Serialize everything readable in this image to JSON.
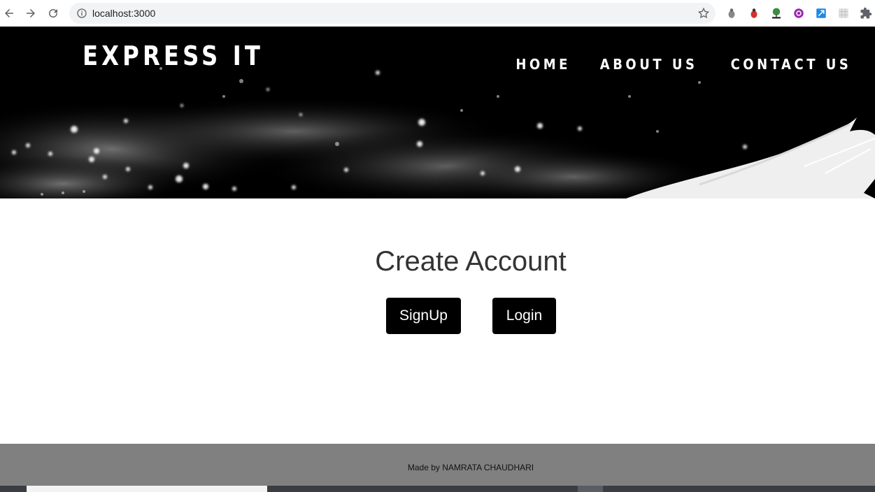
{
  "browser": {
    "url": "localhost:3000",
    "icons": [
      "back-icon",
      "forward-icon",
      "reload-icon",
      "info-icon",
      "star-icon",
      "bug-icon",
      "ladybug-icon",
      "tree-icon",
      "ext-purple-icon",
      "ext-blue-icon",
      "ext-grid-icon",
      "puzzle-icon"
    ]
  },
  "header": {
    "brand": "EXPRESS IT",
    "nav": [
      "HOME",
      "ABOUT US",
      "CONTACT US"
    ]
  },
  "main": {
    "title": "Create Account",
    "signup_label": "SignUp",
    "login_label": "Login"
  },
  "footer": {
    "text": "Made by NAMRATA CHAUDHARI"
  },
  "colors": {
    "hero_bg": "#000000",
    "button_bg": "#000000",
    "footer_bg": "#808080"
  }
}
